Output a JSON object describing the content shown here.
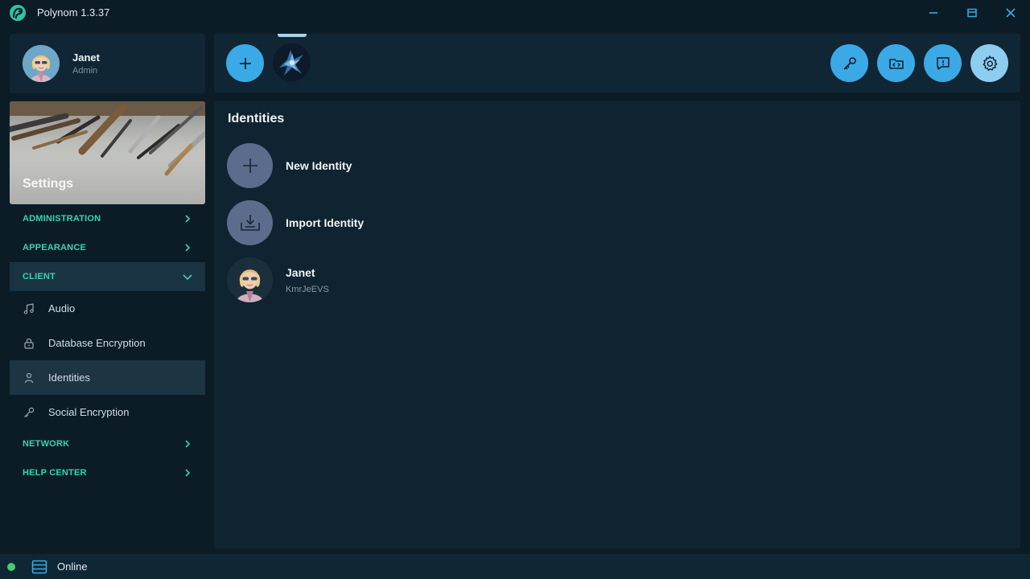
{
  "window": {
    "title": "Polynom 1.3.37"
  },
  "user": {
    "name": "Janet",
    "role": "Admin"
  },
  "sidebar": {
    "banner_label": "Settings",
    "sections": [
      {
        "label": "ADMINISTRATION",
        "expanded": false
      },
      {
        "label": "APPEARANCE",
        "expanded": false
      },
      {
        "label": "CLIENT",
        "expanded": true
      },
      {
        "label": "NETWORK",
        "expanded": false
      },
      {
        "label": "HELP CENTER",
        "expanded": false
      }
    ],
    "client_items": [
      {
        "label": "Audio",
        "icon": "music-note-icon"
      },
      {
        "label": "Database Encryption",
        "icon": "lock-icon"
      },
      {
        "label": "Identities",
        "icon": "person-icon",
        "active": true
      },
      {
        "label": "Social Encryption",
        "icon": "key-icon"
      }
    ]
  },
  "toolbar": {
    "buttons": [
      "add-icon",
      "key-icon",
      "code-folder-icon",
      "feedback-icon",
      "gear-icon"
    ]
  },
  "main": {
    "title": "Identities",
    "new_identity_label": "New Identity",
    "import_identity_label": "Import Identity",
    "identities": [
      {
        "name": "Janet",
        "code": "KmrJeEVS"
      }
    ]
  },
  "status": {
    "text": "Online",
    "color": "#4cc96f"
  },
  "colors": {
    "accent": "#3ba9e6",
    "section_text": "#34d4b4",
    "background": "#0b1c27",
    "panel": "#102634"
  }
}
